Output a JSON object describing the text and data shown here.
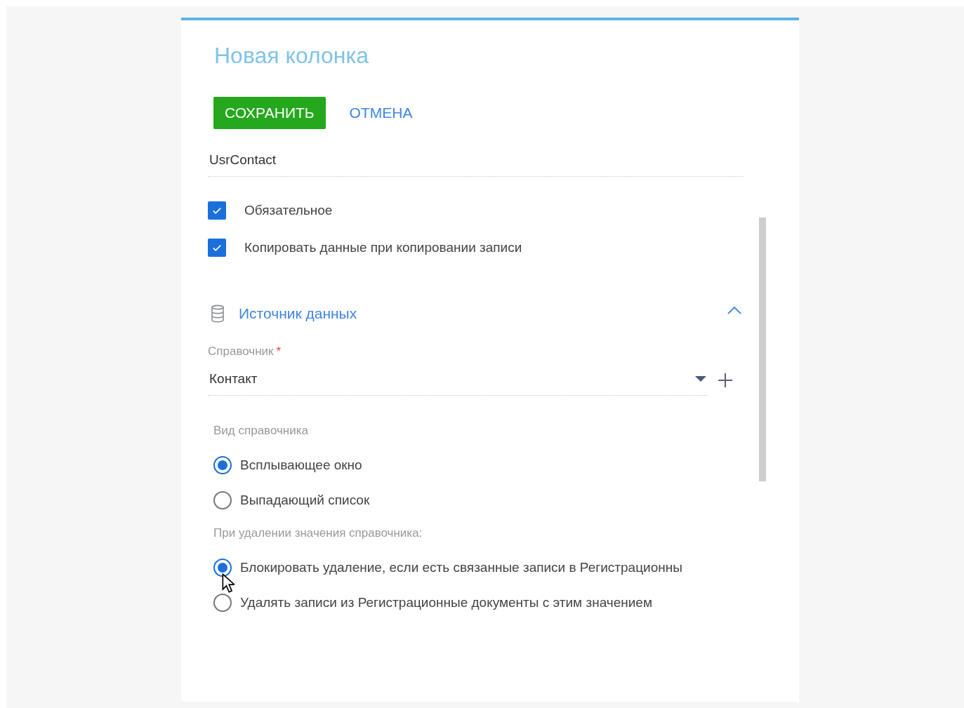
{
  "title": "Новая колонка",
  "buttons": [
    {
      "kind": "primary",
      "label": "СОХРАНИТЬ"
    },
    {
      "kind": "link",
      "label": "ОТМЕНА"
    }
  ],
  "name_field": {
    "value": "UsrContact"
  },
  "checkboxes": [
    {
      "label": "Обязательное",
      "checked": true
    },
    {
      "label": "Копировать данные при копировании записи",
      "checked": true
    }
  ],
  "section": {
    "title": "Источник данных",
    "expanded": true,
    "lookup": {
      "label": "Справочник",
      "required_mark": "*",
      "value": "Контакт"
    },
    "radio_groups": [
      {
        "label": "Вид справочника",
        "options": [
          {
            "label": "Всплывающее окно",
            "selected": true
          },
          {
            "label": "Выпадающий список",
            "selected": false
          }
        ]
      },
      {
        "label": "При удалении значения справочника:",
        "options": [
          {
            "label": "Блокировать удаление, если есть связанные записи в Регистрационны",
            "selected": true
          },
          {
            "label": "Удалять записи из Регистрационные документы с этим значением",
            "selected": false
          }
        ]
      }
    ]
  }
}
